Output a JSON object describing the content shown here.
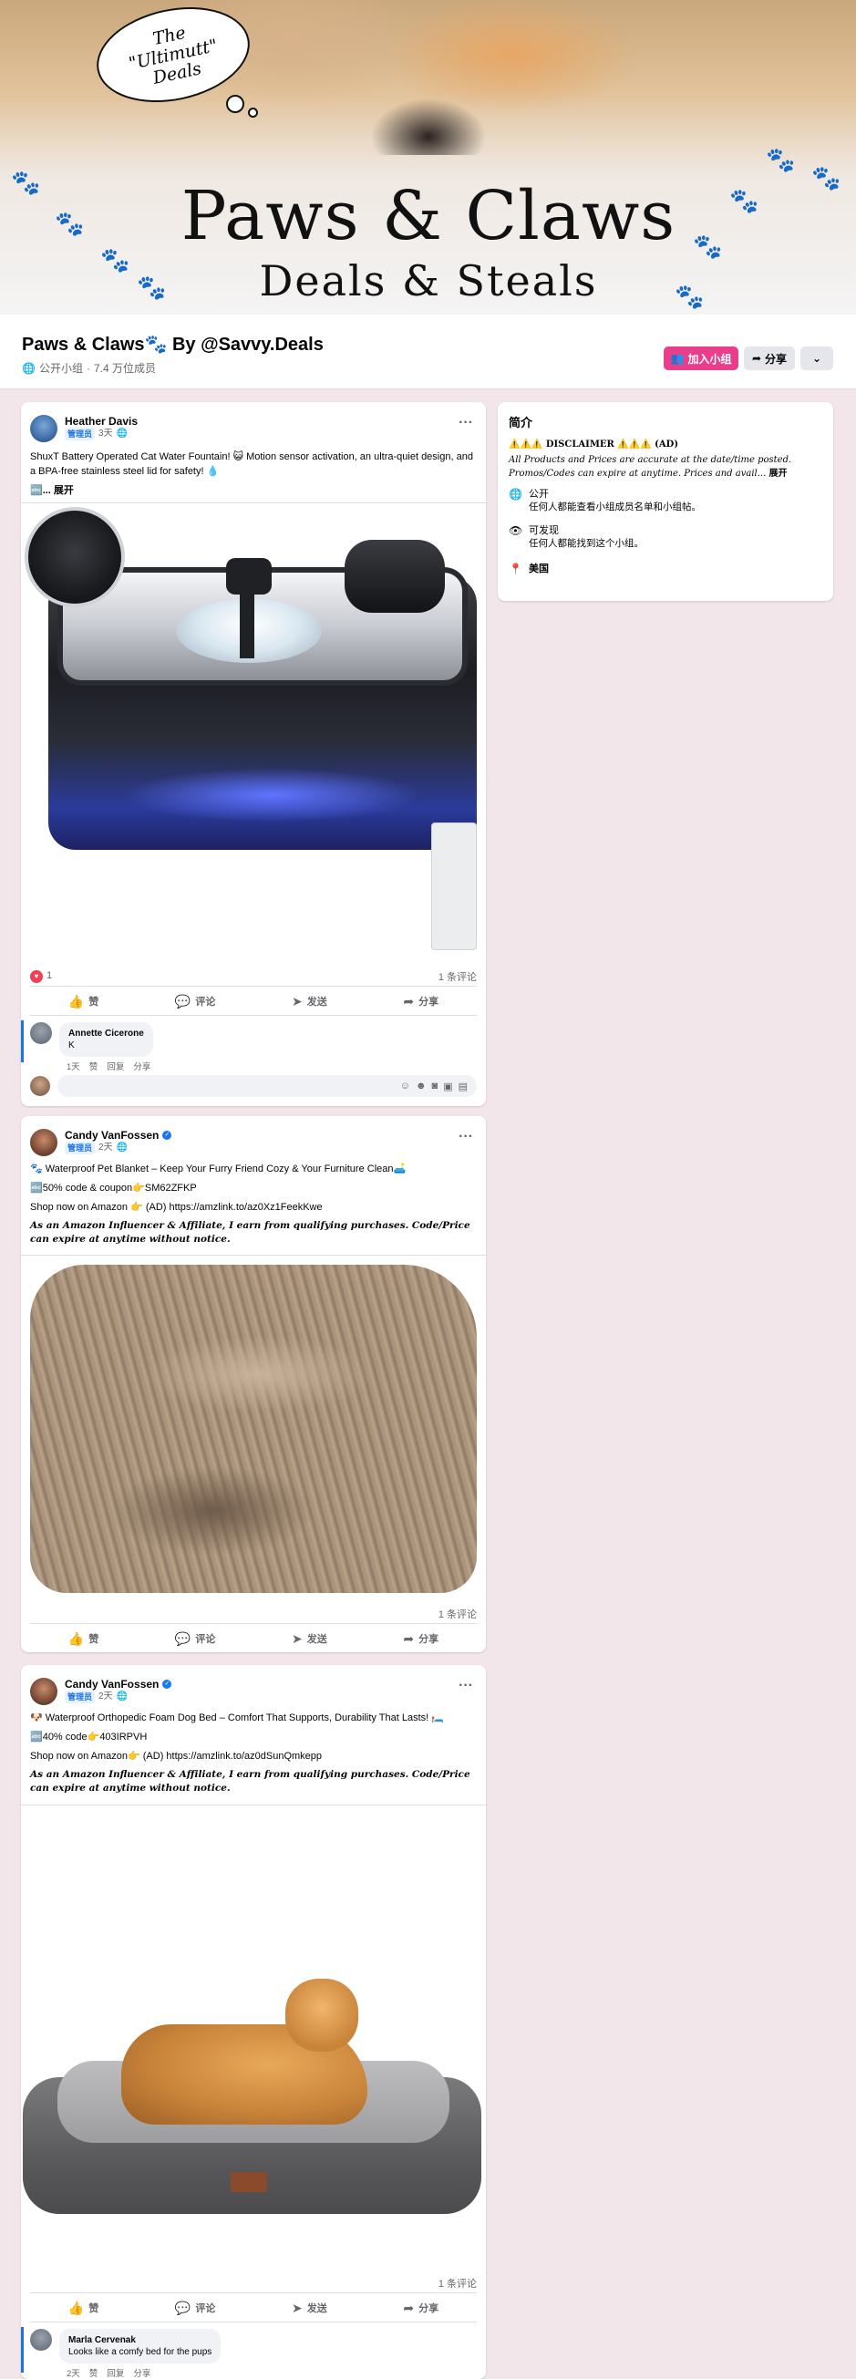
{
  "cover": {
    "bubble_lines": [
      "The",
      "\"Ultimutt\"",
      "Deals"
    ],
    "brand_line1": "Paws & Claws",
    "brand_line2": "Deals & Steals"
  },
  "group": {
    "title": "Paws & Claws🐾 By @Savvy.Deals",
    "privacy": "公开小组",
    "separator": "·",
    "members": "7.4 万位成员",
    "join_label": "加入小组",
    "share_label": "分享",
    "more_label": "⌄"
  },
  "posts": [
    {
      "author": "Heather Davis",
      "badge": "管理员",
      "time": "3天",
      "paragraphs": [
        "ShuxT Battery Operated Cat Water Fountain! 😺 Motion sensor activation, an ultra-quiet design, and a BPA-free stainless steel lid for safety! 💧"
      ],
      "see_more": "🔤... 展开",
      "reactions": "1",
      "comments_count": "1 条评论",
      "actions": [
        "赞",
        "评论",
        "发送",
        "分享"
      ],
      "comment": {
        "name": "Annette Cicerone",
        "text": "K",
        "time": "1天",
        "like": "赞",
        "reply": "回复",
        "share": "分享"
      }
    },
    {
      "author": "Candy VanFossen",
      "badge": "管理员",
      "time": "2天",
      "paragraphs": [
        "🐾 Waterproof Pet Blanket – Keep Your Furry Friend Cozy & Your Furniture Clean🛋️",
        "🔤50% code & coupon👉SM62ZFKP",
        "Shop now on Amazon 👉 (AD) https://amzlink.to/az0Xz1FeekKwe"
      ],
      "disclaimer": "As an Amazon Influencer & Affiliate, I earn from qualifying purchases. Code/Price can expire at anytime without notice.",
      "comments_count": "1 条评论",
      "actions": [
        "赞",
        "评论",
        "发送",
        "分享"
      ]
    },
    {
      "author": "Candy VanFossen",
      "badge": "管理员",
      "time": "2天",
      "paragraphs": [
        "🐶 Waterproof Orthopedic Foam Dog Bed – Comfort That Supports, Durability That Lasts! 🛏️",
        "🔤40% code👉403IRPVH",
        "Shop now on Amazon👉 (AD) https://amzlink.to/az0dSunQmkepp"
      ],
      "disclaimer": "As an Amazon Influencer & Affiliate, I earn from qualifying purchases. Code/Price can expire at anytime without notice.",
      "comments_count": "1 条评论",
      "actions": [
        "赞",
        "评论",
        "发送",
        "分享"
      ],
      "comment": {
        "name": "Marla Cervenak",
        "text": "Looks like a comfy bed for the pups",
        "time": "2天",
        "like": "赞",
        "reply": "回复",
        "share": "分享"
      }
    }
  ],
  "about": {
    "title": "简介",
    "disclaimer_head": "⚠️⚠️⚠️ DISCLAIMER ⚠️⚠️⚠️ (AD)",
    "disclaimer_body": "All Products and Prices are accurate at the date/time posted. Promos/Codes can expire at anytime. Prices and avail...",
    "see_more": "展开",
    "items": [
      {
        "title": "公开",
        "sub": "任何人都能查看小组成员名单和小组帖。"
      },
      {
        "title": "可发现",
        "sub": "任何人都能找到这个小组。"
      },
      {
        "title": "美国",
        "sub": ""
      }
    ]
  },
  "colors": {
    "accent": "#e83e8c",
    "page_bg": "#f3e6ea",
    "link_blue": "#1b74e4"
  },
  "icons": {
    "privacy": "globe-icon",
    "share": "share-arrow-icon",
    "more": "chevron-down-icon",
    "location": "location-pin-icon",
    "visible": "eye-icon"
  }
}
